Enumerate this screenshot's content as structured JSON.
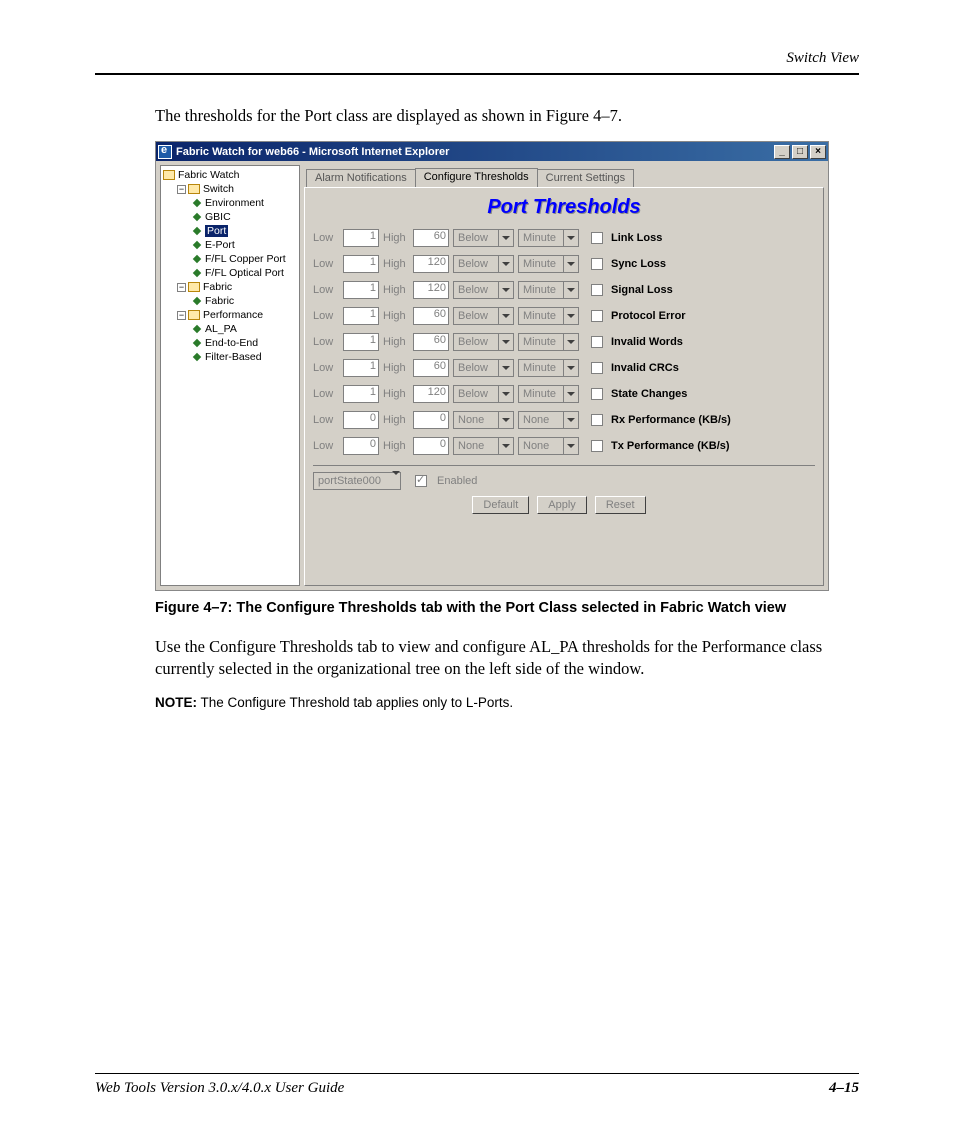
{
  "header": {
    "right": "Switch View"
  },
  "intro": "The thresholds for the Port class are displayed as shown in Figure 4–7.",
  "screenshot": {
    "title": "Fabric Watch for web66 - Microsoft Internet Explorer",
    "winbtns": {
      "min": "_",
      "max": "□",
      "close": "×"
    },
    "tree": {
      "root": "Fabric Watch",
      "switch": {
        "label": "Switch",
        "items": [
          "Environment",
          "GBIC",
          "Port",
          "E-Port",
          "F/FL Copper Port",
          "F/FL Optical Port"
        ],
        "selected": "Port"
      },
      "fabric": {
        "label": "Fabric",
        "items": [
          "Fabric"
        ]
      },
      "performance": {
        "label": "Performance",
        "items": [
          "AL_PA",
          "End-to-End",
          "Filter-Based"
        ]
      }
    },
    "tabs": [
      "Alarm Notifications",
      "Configure Thresholds",
      "Current Settings"
    ],
    "active_tab": "Configure Thresholds",
    "panel_title": "Port Thresholds",
    "labels": {
      "low": "Low",
      "high": "High"
    },
    "rows": [
      {
        "low": "1",
        "high": "60",
        "cond": "Below",
        "period": "Minute",
        "name": "Link Loss"
      },
      {
        "low": "1",
        "high": "120",
        "cond": "Below",
        "period": "Minute",
        "name": "Sync Loss"
      },
      {
        "low": "1",
        "high": "120",
        "cond": "Below",
        "period": "Minute",
        "name": "Signal Loss"
      },
      {
        "low": "1",
        "high": "60",
        "cond": "Below",
        "period": "Minute",
        "name": "Protocol Error"
      },
      {
        "low": "1",
        "high": "60",
        "cond": "Below",
        "period": "Minute",
        "name": "Invalid Words"
      },
      {
        "low": "1",
        "high": "60",
        "cond": "Below",
        "period": "Minute",
        "name": "Invalid CRCs"
      },
      {
        "low": "1",
        "high": "120",
        "cond": "Below",
        "period": "Minute",
        "name": "State Changes"
      },
      {
        "low": "0",
        "high": "0",
        "cond": "None",
        "period": "None",
        "name": "Rx Performance (KB/s)"
      },
      {
        "low": "0",
        "high": "0",
        "cond": "None",
        "period": "None",
        "name": "Tx Performance (KB/s)"
      }
    ],
    "footer": {
      "port_select": "portState000",
      "enabled_label": "Enabled",
      "buttons": {
        "default": "Default",
        "apply": "Apply",
        "reset": "Reset"
      }
    }
  },
  "caption": "Figure 4–7:  The Configure Thresholds tab with the Port Class selected in Fabric Watch view",
  "paragraph2": "Use the Configure Thresholds tab to view and configure AL_PA thresholds for the Performance class currently selected in the organizational tree on the left side of the window.",
  "note_label": "NOTE:",
  "note_text": "  The Configure Threshold tab applies only to L-Ports.",
  "footer": {
    "left": "Web Tools Version 3.0.x/4.0.x User Guide",
    "right": "4–15"
  }
}
